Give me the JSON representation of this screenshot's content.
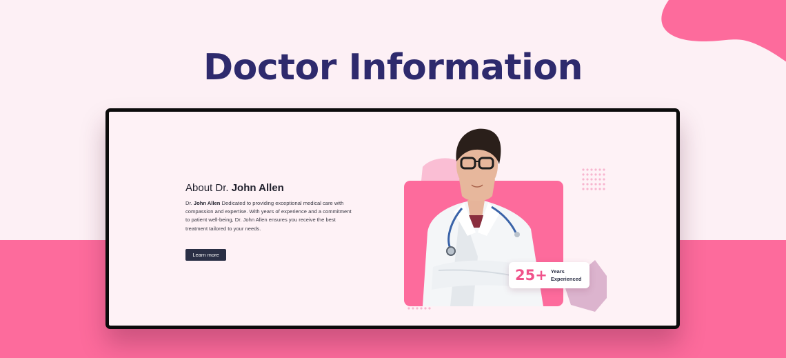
{
  "page": {
    "title": "Doctor Information"
  },
  "about": {
    "heading_prefix": "About Dr.",
    "doctor_name": "John Allen",
    "text_prefix": "Dr.",
    "text_body": "Dedicated to providing exceptional medical care with compassion and expertise. With years of experience and a commitment to patient well-being, Dr. John Allen ensures you receive the best treatment tailored to your needs.",
    "button_label": "Learn more"
  },
  "stat": {
    "number": "25+",
    "label_line1": "Years",
    "label_line2": "Experienced"
  },
  "colors": {
    "accent_pink": "#fd6b9c",
    "title_navy": "#2e2a6d",
    "button_dark": "#2a2f45"
  },
  "images": {
    "portrait": "doctor-portrait"
  }
}
